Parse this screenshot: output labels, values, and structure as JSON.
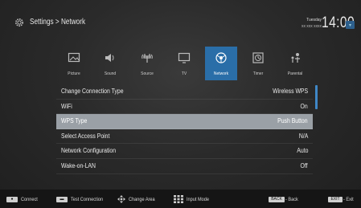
{
  "header": {
    "title": "Settings > Network",
    "day": "Tuesday",
    "date": "xx xxx xxxx",
    "time": "14:00"
  },
  "categories": [
    {
      "label": "Picture",
      "icon": "picture-icon",
      "active": false
    },
    {
      "label": "Sound",
      "icon": "sound-icon",
      "active": false
    },
    {
      "label": "Source",
      "icon": "source-icon",
      "active": false
    },
    {
      "label": "TV",
      "icon": "tv-icon",
      "active": false
    },
    {
      "label": "Network",
      "icon": "network-icon",
      "active": true
    },
    {
      "label": "Timer",
      "icon": "timer-icon",
      "active": false
    },
    {
      "label": "Parental",
      "icon": "parental-icon",
      "active": false
    }
  ],
  "menu": [
    {
      "label": "Change Connection Type",
      "value": "Wireless WPS",
      "selected": false
    },
    {
      "label": "WiFi",
      "value": "On",
      "selected": false
    },
    {
      "label": "WPS Type",
      "value": "Push Button",
      "selected": true
    },
    {
      "label": "Select Access Point",
      "value": "N/A",
      "selected": false
    },
    {
      "label": "Network Configuration",
      "value": "Auto",
      "selected": false
    },
    {
      "label": "Wake-on-LAN",
      "value": "Off",
      "selected": false
    }
  ],
  "footer": {
    "connect": "Connect",
    "test_connection": "Test Connection",
    "change_area": "Change Area",
    "input_mode": "Input Mode",
    "back_key": "BACK",
    "back": "- Back",
    "exit_key": "EXIT",
    "exit": "- Exit"
  },
  "colors": {
    "accent": "#2a6ea8",
    "selected_row": "#9aa0a6",
    "background": "#2a2a2a"
  }
}
